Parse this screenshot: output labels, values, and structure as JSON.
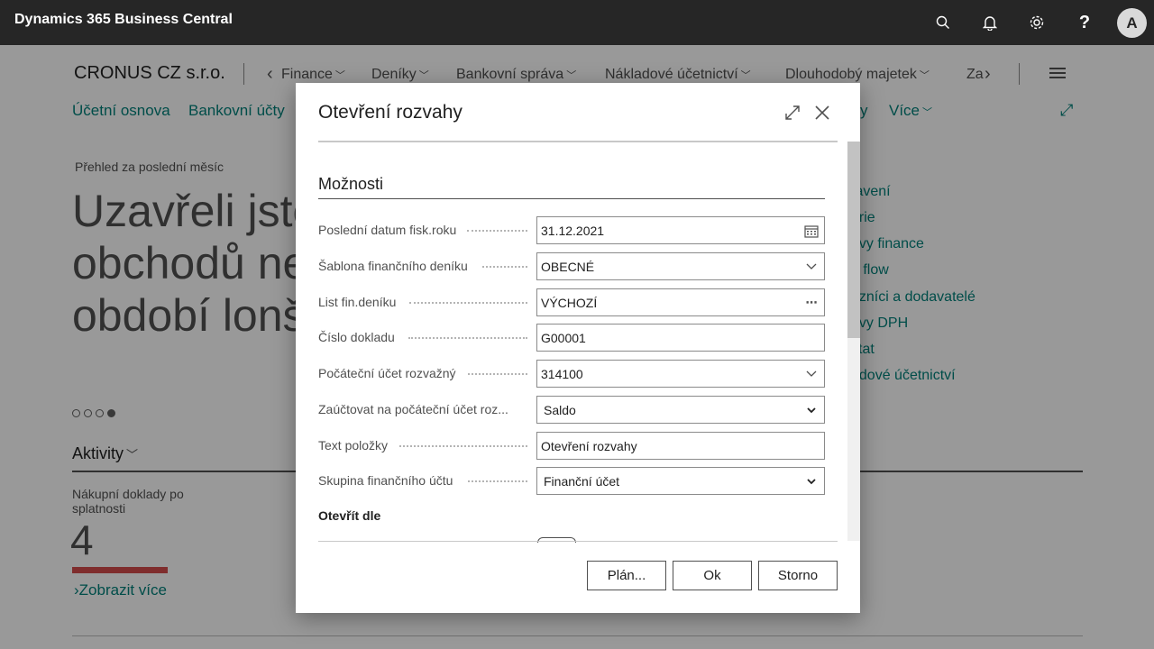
{
  "app": {
    "title": "Dynamics 365 Business Central",
    "avatar_letter": "A"
  },
  "topbar_icons": [
    "search-icon",
    "bell-icon",
    "gear-icon",
    "help-icon"
  ],
  "background": {
    "company": "CRONUS CZ s.r.o.",
    "top_nav": [
      "Finance",
      "Deníky",
      "Bankovní správa",
      "Nákladové účetnictví",
      "Dlouhodobý majetek",
      "Za"
    ],
    "nav_links": [
      "Účetní osnova",
      "Bankovní účty",
      "y",
      "Více"
    ],
    "summary_caption": "Přehled za poslední měsíc",
    "headline": "Uzavřeli jste obchodů ne období lonš",
    "side_links": [
      "tavení",
      "orie",
      "avy finance",
      "h flow",
      "azníci a dodavatelé",
      "avy DPH",
      "stat",
      "adové účetnictví"
    ],
    "activities": "Aktivity",
    "tile_label": "Nákupní doklady po splatnosti",
    "tile_value": "4",
    "show_more": "Zobrazit více"
  },
  "dialog": {
    "title": "Otevření rozvahy",
    "section_title": "Možnosti",
    "fields": [
      {
        "label": "Poslední datum fisk.roku",
        "value": "31.12.2021",
        "icon": "calendar-icon"
      },
      {
        "label": "Šablona finančního deníku",
        "value": "OBECNÉ",
        "icon": "chevron-down-icon"
      },
      {
        "label": "List fin.deníku",
        "value": "VÝCHOZÍ",
        "icon": "ellipsis-icon"
      },
      {
        "label": "Číslo dokladu",
        "value": "G00001",
        "icon": ""
      },
      {
        "label": "Počáteční účet rozvažný",
        "value": "314100",
        "icon": "chevron-down-icon"
      },
      {
        "label": "Zaúčtovat na počáteční účet roz...",
        "value": "Saldo",
        "icon": "select-arrow-icon"
      },
      {
        "label": "Text položky",
        "value": "Otevření rozvahy",
        "icon": ""
      },
      {
        "label": "Skupina finančního účtu",
        "value": "Finanční účet",
        "icon": "select-arrow-icon"
      }
    ],
    "subheader": "Otevřít dle",
    "buttons": {
      "schedule": "Plán...",
      "ok": "Ok",
      "cancel": "Storno"
    }
  }
}
